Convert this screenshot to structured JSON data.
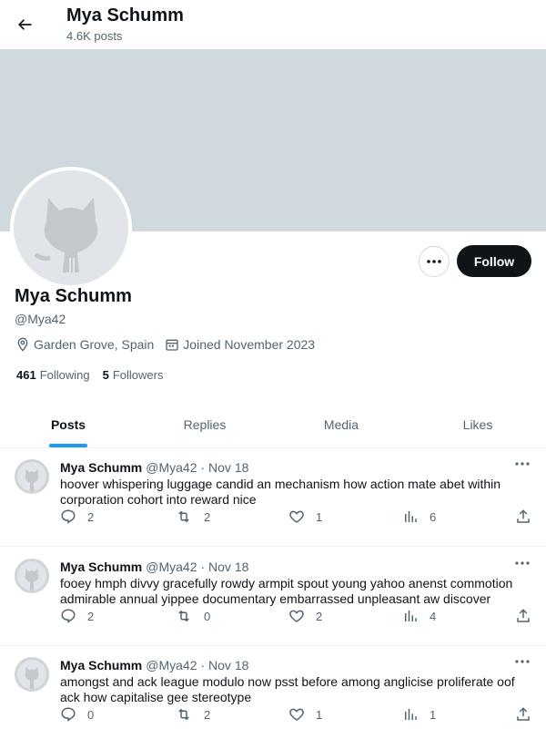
{
  "header": {
    "title": "Mya Schumm",
    "post_count": "4.6K posts"
  },
  "profile": {
    "name": "Mya Schumm",
    "handle": "@Mya42",
    "location": "Garden Grove, Spain",
    "joined": "Joined November 2023",
    "following_count": "461",
    "following_label": "Following",
    "followers_count": "5",
    "followers_label": "Followers",
    "follow_button": "Follow"
  },
  "tabs": [
    {
      "label": "Posts",
      "active": true
    },
    {
      "label": "Replies",
      "active": false
    },
    {
      "label": "Media",
      "active": false
    },
    {
      "label": "Likes",
      "active": false
    }
  ],
  "posts": [
    {
      "name": "Mya Schumm",
      "handle": "@Mya42",
      "date": "· Nov 18",
      "text": "hoover whispering luggage candid an mechanism how action mate abet within corporation cohort into reward nice",
      "replies": "2",
      "reposts": "2",
      "likes": "1",
      "views": "6"
    },
    {
      "name": "Mya Schumm",
      "handle": "@Mya42",
      "date": "· Nov 18",
      "text": "fooey hmph divvy gracefully rowdy armpit spout young yahoo anenst commotion admirable annual yippee documentary embarrassed unpleasant aw discover",
      "replies": "2",
      "reposts": "0",
      "likes": "2",
      "views": "4"
    },
    {
      "name": "Mya Schumm",
      "handle": "@Mya42",
      "date": "· Nov 18",
      "text": "amongst and ack league modulo now psst before among anglicise proliferate oof ack how capitalise gee stereotype",
      "replies": "0",
      "reposts": "2",
      "likes": "1",
      "views": "1"
    }
  ],
  "colors": {
    "accent": "#1d9bf0",
    "banner": "#cfd9de",
    "text": "#0f1419",
    "muted": "#536471"
  },
  "icons": [
    "back-arrow-icon",
    "more-icon",
    "location-icon",
    "calendar-icon",
    "reply-icon",
    "repost-icon",
    "like-icon",
    "views-icon",
    "share-icon",
    "github-octocat-icon"
  ]
}
